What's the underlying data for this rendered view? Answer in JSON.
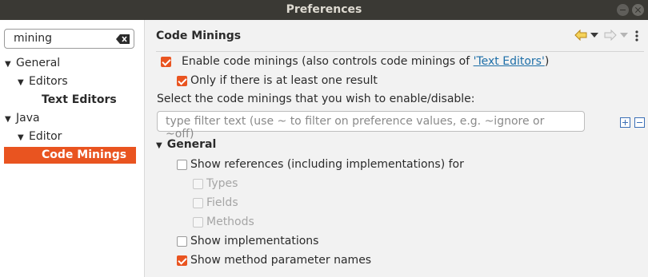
{
  "window": {
    "title": "Preferences"
  },
  "sidebar": {
    "search_value": "mining",
    "tree": [
      {
        "label": "General",
        "expanded": true,
        "level": 0
      },
      {
        "label": "Editors",
        "expanded": true,
        "level": 1
      },
      {
        "label": "Text Editors",
        "level": 2,
        "bold": true
      },
      {
        "label": "Java",
        "expanded": true,
        "level": 0
      },
      {
        "label": "Editor",
        "expanded": true,
        "level": 1
      },
      {
        "label": "Code Minings",
        "level": 2,
        "bold": true,
        "selected": true
      }
    ]
  },
  "main": {
    "title": "Code Minings",
    "enable": {
      "label": "Enable code minings (also controls code minings of ",
      "link": "'Text Editors'",
      "suffix": ")",
      "checked": true
    },
    "only_if": {
      "label": "Only if there is at least one result",
      "checked": true
    },
    "select_label": "Select the code minings that you wish to enable/disable:",
    "filter_placeholder": "type filter text (use ~ to filter on preference values, e.g. ~ignore or ~off)",
    "group": "General",
    "options": [
      {
        "label": "Show references (including implementations) for",
        "checked": false,
        "enabled": true
      },
      {
        "label": "Types",
        "checked": false,
        "enabled": false
      },
      {
        "label": "Fields",
        "checked": false,
        "enabled": false
      },
      {
        "label": "Methods",
        "checked": false,
        "enabled": false
      },
      {
        "label": "Show implementations",
        "checked": false,
        "enabled": true
      },
      {
        "label": "Show method parameter names",
        "checked": true,
        "enabled": true
      }
    ]
  },
  "colors": {
    "accent": "#e95420",
    "link": "#1e6fa8",
    "titlebar": "#3a3934"
  },
  "icons": [
    "clear-search-icon",
    "back-icon",
    "forward-icon",
    "menu-icon",
    "expand-all-icon",
    "collapse-all-icon"
  ]
}
